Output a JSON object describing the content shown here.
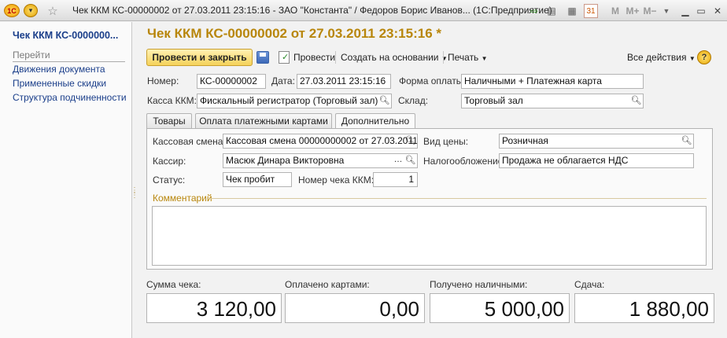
{
  "window": {
    "title": "Чек ККМ КС-00000002 от 27.03.2011 23:15:16 - ЗАО \"Константа\" / Федоров Борис Иванов... (1С:Предприятие)",
    "logo_text": "1С",
    "icons": [
      "logo-icon",
      "menu-circle-icon",
      "star-icon",
      "forward-icon",
      "doc-icon",
      "calculator-icon",
      "calendar-icon"
    ],
    "calendar_text": "31",
    "m_label": "M",
    "mplus_label": "M+",
    "mminus_label": "M−"
  },
  "sidebar": {
    "title": "Чек ККМ КС-0000000...",
    "section": "Перейти",
    "items": [
      {
        "label": "Движения документа"
      },
      {
        "label": "Примененные скидки"
      },
      {
        "label": "Структура подчиненности"
      }
    ]
  },
  "document": {
    "title": "Чек ККМ КС-00000002 от 27.03.2011 23:15:16 *"
  },
  "toolbar": {
    "post_close_label": "Провести и закрыть",
    "post_label": "Провести",
    "create_based_label": "Создать на основании",
    "print_label": "Печать",
    "all_actions_label": "Все действия",
    "help_label": "?"
  },
  "header": {
    "number_label": "Номер:",
    "number_value": "КС-00000002",
    "date_label": "Дата:",
    "date_value": "27.03.2011 23:15:16",
    "payment_form_label": "Форма оплаты:",
    "payment_form_value": "Наличными + Платежная карта",
    "kkm_label": "Касса ККМ:",
    "kkm_value": "Фискальный регистратор (Торговый зал)",
    "warehouse_label": "Склад:",
    "warehouse_value": "Торговый зал"
  },
  "tabs": [
    {
      "label": "Товары"
    },
    {
      "label": "Оплата платежными картами"
    },
    {
      "label": "Дополнительно"
    }
  ],
  "additional": {
    "shift_label": "Кассовая смена:",
    "shift_value": "Кассовая смена 00000000002 от 27.03.2011",
    "price_type_label": "Вид цены:",
    "price_type_value": "Розничная",
    "cashier_label": "Кассир:",
    "cashier_value": "Масюк Динара Викторовна",
    "taxation_label": "Налогообложение:",
    "taxation_value": "Продажа не облагается НДС",
    "status_label": "Статус:",
    "status_value": "Чек пробит",
    "check_number_label": "Номер чека ККМ:",
    "check_number_value": "1",
    "comment_label": "Комментарий"
  },
  "totals": {
    "sum_label": "Сумма чека:",
    "sum_value": "3 120,00",
    "cards_label": "Оплачено картами:",
    "cards_value": "0,00",
    "cash_label": "Получено наличными:",
    "cash_value": "5 000,00",
    "change_label": "Сдача:",
    "change_value": "1 880,00"
  },
  "colors": {
    "title_gold": "#b8860b",
    "link_blue": "#1a3e8a",
    "primary_button": "#f5d25a"
  }
}
